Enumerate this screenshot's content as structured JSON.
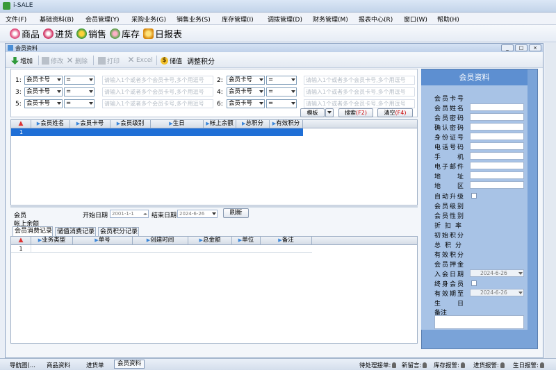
{
  "app": {
    "title": "i-SALE"
  },
  "menu": [
    "文件(F)",
    "基础资料(B)",
    "会员管理(Y)",
    "采购业务(G)",
    "销售业务(S)",
    "库存管理(I)",
    "调拨管理(D)",
    "财务管理(M)",
    "报表中心(R)",
    "窗口(W)",
    "帮助(H)"
  ],
  "quickbar": [
    "商品",
    "进货",
    "销售",
    "库存",
    "日报表"
  ],
  "child": {
    "title": "会员资料",
    "window_buttons": [
      "_",
      "□",
      "×"
    ],
    "toolbar": {
      "add": "增加",
      "edit": "修改",
      "delete": "删除",
      "print": "打印",
      "excel": "Excel",
      "topup": "储值",
      "adjust_points": "调整积分"
    }
  },
  "filter": {
    "rows": [
      {
        "num": "1:",
        "field": "会员卡号",
        "op": "="
      },
      {
        "num": "2:",
        "field": "会员卡号",
        "op": "="
      },
      {
        "num": "3:",
        "field": "会员卡号",
        "op": "="
      },
      {
        "num": "4:",
        "field": "会员卡号",
        "op": "="
      },
      {
        "num": "5:",
        "field": "会员卡号",
        "op": "="
      },
      {
        "num": "6:",
        "field": "会员卡号",
        "op": "="
      }
    ],
    "placeholder": "请输入1个或者多个会员卡号,多个用逗号",
    "template_btn": "模板",
    "search_btn": "搜索",
    "search_key": "(F2)",
    "clear_btn": "清空",
    "clear_key": "(F4)"
  },
  "member_grid": {
    "columns": [
      "会员姓名",
      "会员卡号",
      "会员级别",
      "生日",
      "帐上余额",
      "总积分",
      "有效积分"
    ],
    "row_num": "1"
  },
  "history": {
    "member_label": "会员",
    "start_label": "开始日期",
    "start_value": "2001-1-1",
    "end_label": "结束日期",
    "end_value": "2024-6-26",
    "refresh": "刷新",
    "balance_label": "帐上余额",
    "tabs": [
      "会员消费记录",
      "储值消费记录",
      "会员积分记录"
    ],
    "columns": [
      "业务类型",
      "单号",
      "创建时间",
      "总金额",
      "单位",
      "备注"
    ],
    "row_num": "1"
  },
  "info": {
    "title": "会员资料",
    "fields": {
      "card": "会员卡号",
      "name": "会员姓名",
      "pwd": "会员密码",
      "pwd2": "确认密码",
      "id": "身份证号",
      "tel": "电话号码",
      "mobile": "手机",
      "email": "电子邮件",
      "addr": "地址",
      "area": "地区",
      "upgrade": "自动升级",
      "level": "会员级别",
      "gender": "会员性别",
      "discount": "折扣率",
      "init_points": "初始积分",
      "total_points": "总积分",
      "valid_points": "有效积分",
      "deposit": "会员押金",
      "join_date": "入会日期",
      "lifetime": "终身会员",
      "expiry": "有效期至",
      "birthday": "生日",
      "remark": "备注"
    },
    "join_date_value": "2024-6-26",
    "expiry_value": "2024-6-26"
  },
  "statusbar": {
    "tabs": [
      "导航图(...",
      "商品资料",
      "进货单",
      "会员资料"
    ],
    "indicators": [
      "待处理接单:",
      "新留言:",
      "库存报警:",
      "进货报警:",
      "生日报警:"
    ]
  }
}
